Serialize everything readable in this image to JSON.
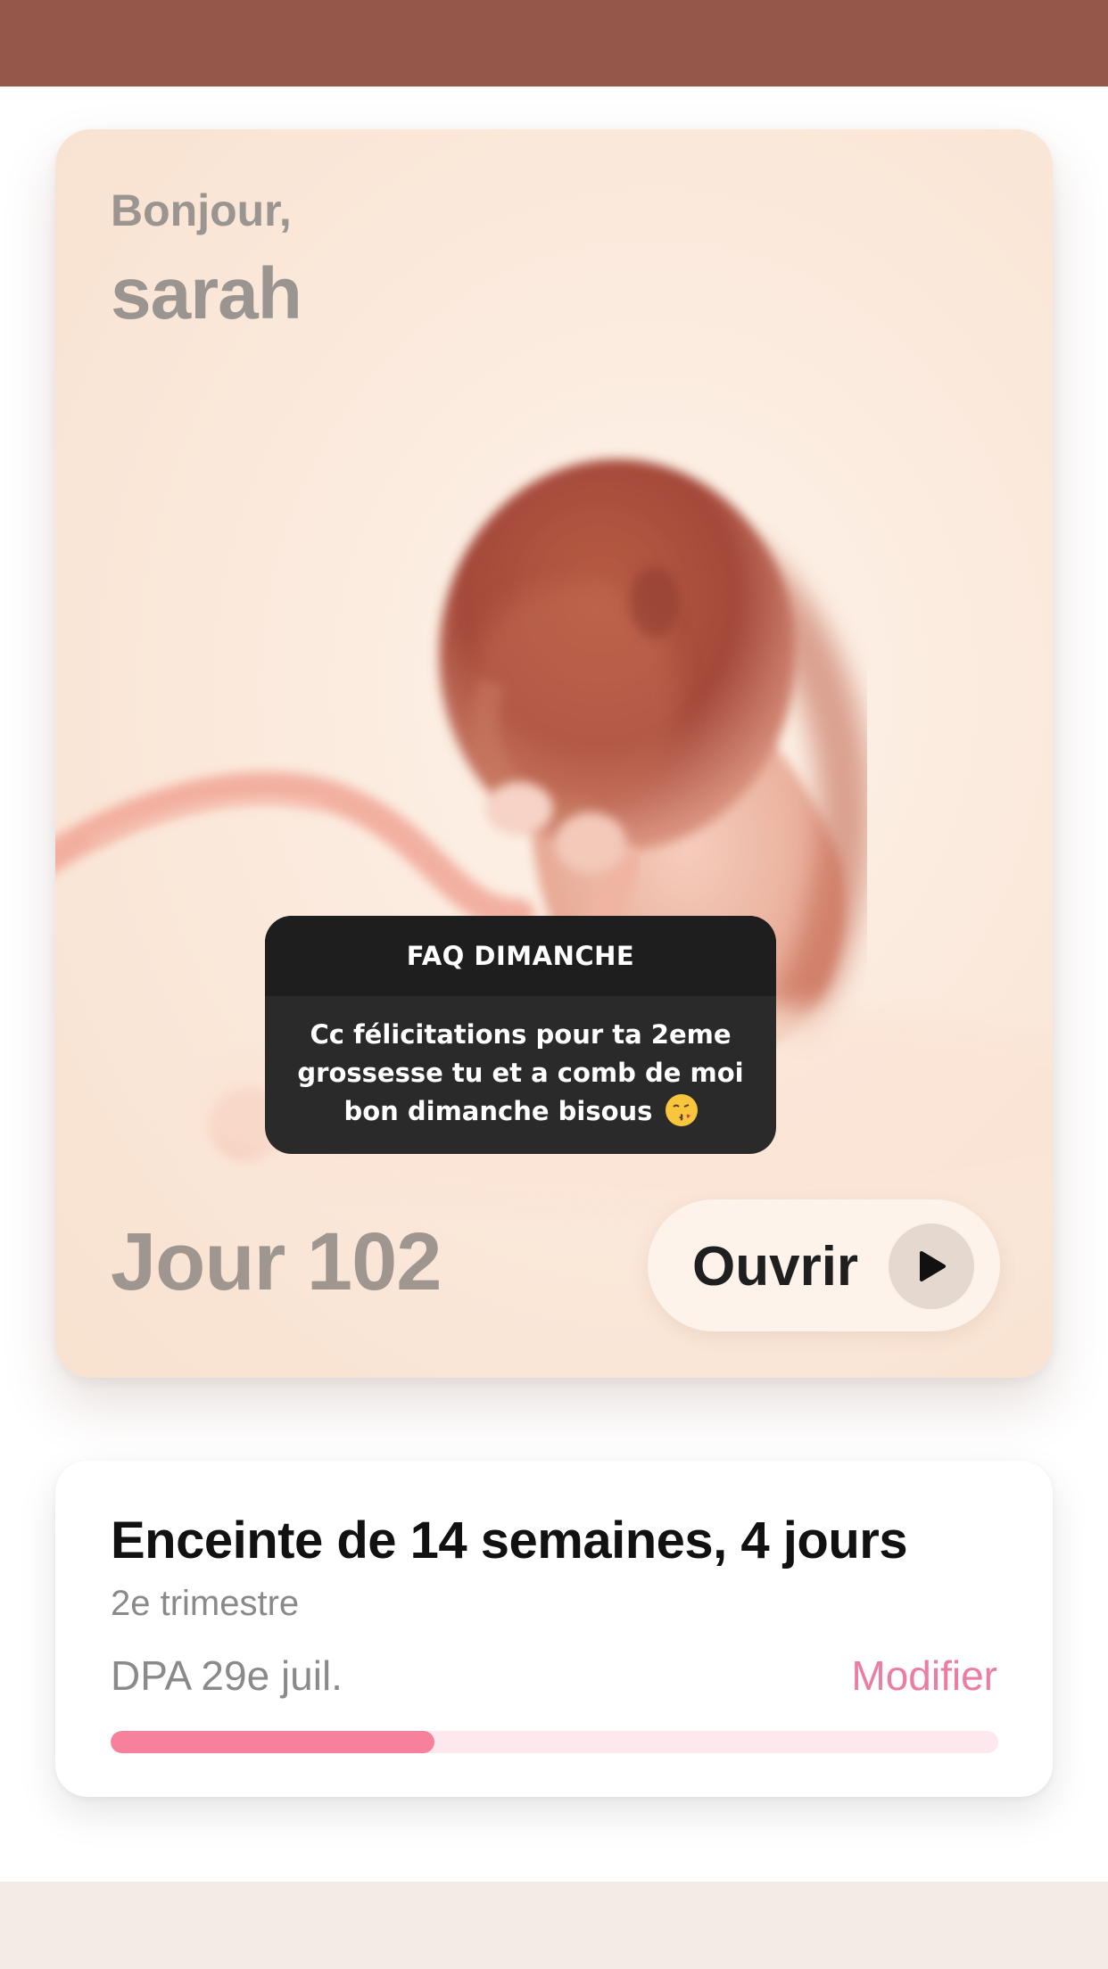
{
  "theme": {
    "header_color": "#93584a",
    "accent_pink": "#f7819c",
    "link_color": "#ec7da2"
  },
  "hero": {
    "greeting": "Bonjour,",
    "name": "sarah",
    "day": "Jour 102",
    "open_label": "Ouvrir",
    "image": "fetus-illustration",
    "play_icon": "play-icon"
  },
  "story_reply": {
    "title": "FAQ DIMANCHE",
    "message": "Cc félicitations pour ta 2eme grossesse tu et a comb de moi bon dimanche  bisous",
    "emoji": "kissing-face-emoji"
  },
  "pregnancy": {
    "title": "Enceinte de 14 semaines, 4 jours",
    "trimester": "2e trimestre",
    "due_date": "DPA 29e juil.",
    "modify_label": "Modifier",
    "progress": 0.365
  }
}
